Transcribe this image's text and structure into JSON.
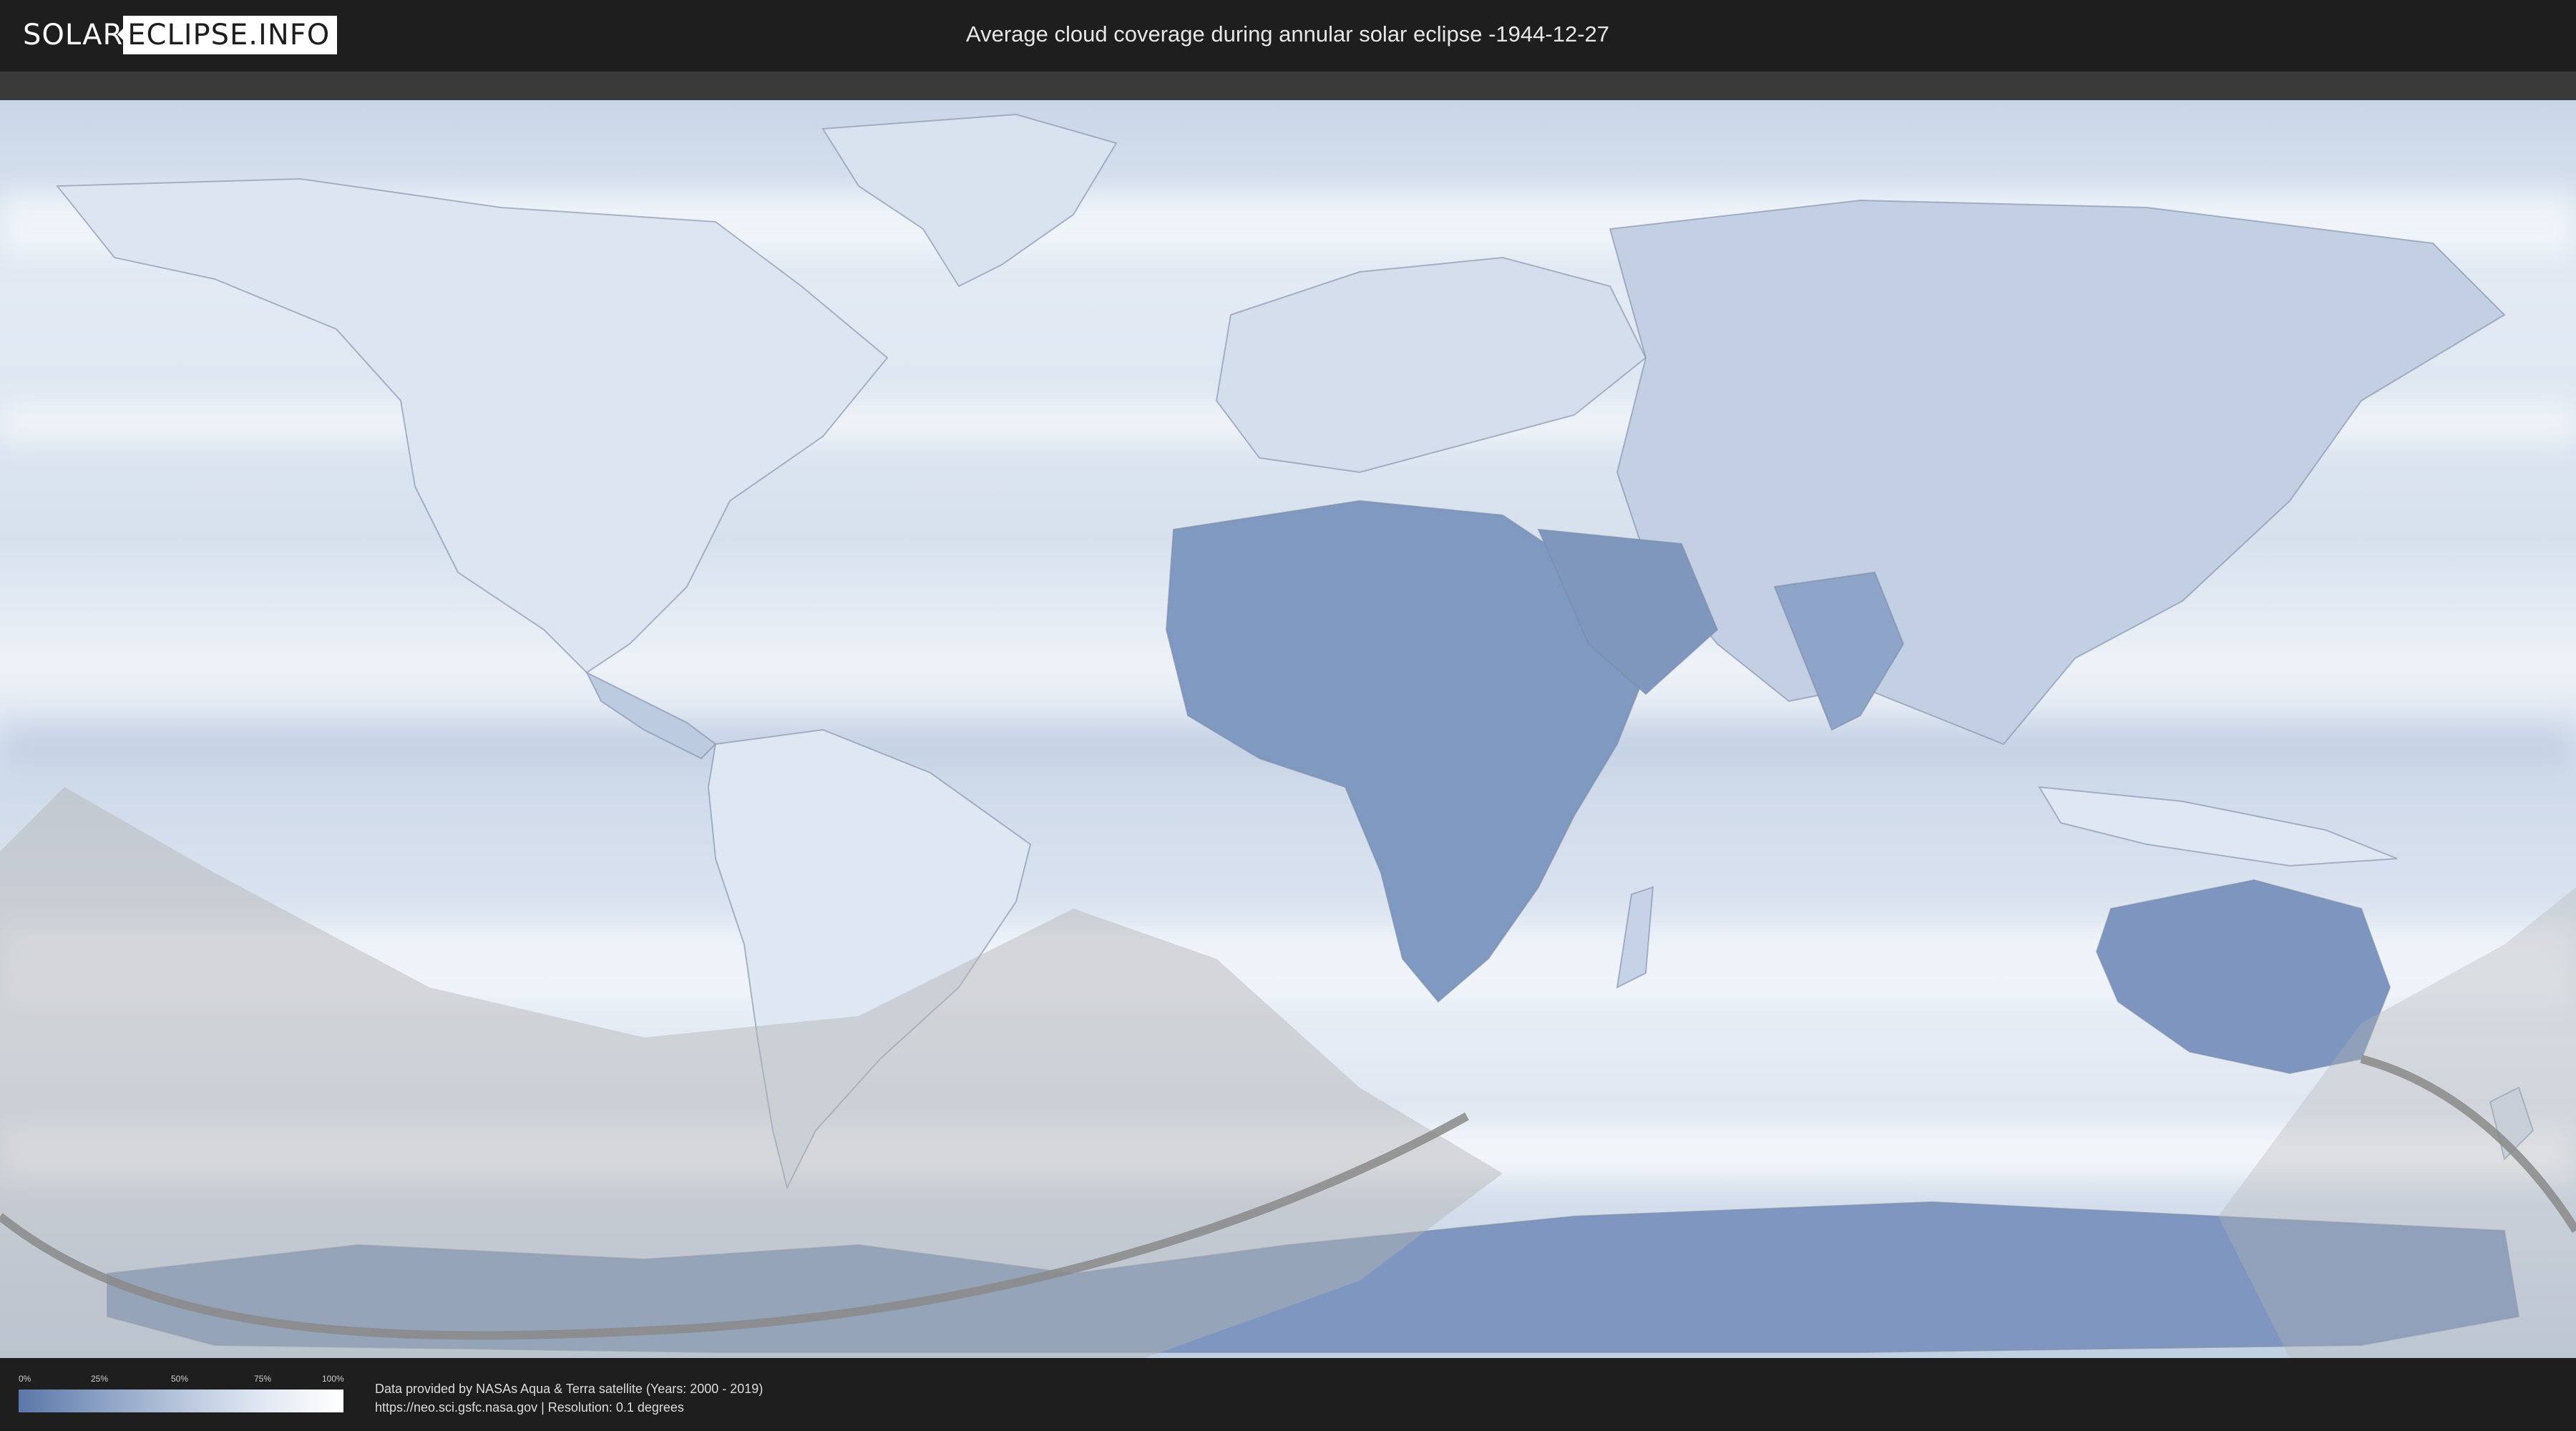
{
  "header": {
    "logo_solar": "SOLAR",
    "logo_eclipse": "ECLIPSE.INFO",
    "title": "Average cloud coverage during annular solar eclipse -1944-12-27"
  },
  "map": {
    "description_layer": "cloud-coverage",
    "colors": {
      "ocean_cloud": "#e9eff7",
      "clear_sky": "#5b77a8",
      "penumbra_shade": "#b4b4b4",
      "path_line": "#8a8a8a"
    }
  },
  "legend": {
    "ticks": [
      "0%",
      "25%",
      "50%",
      "75%",
      "100%"
    ],
    "gradient_from": "#5b77a8",
    "gradient_to": "#ffffff"
  },
  "footer": {
    "credit_line": "Data provided by NASAs Aqua & Terra satellite (Years: 2000 - 2019)",
    "source_line": "https://neo.sci.gsfc.nasa.gov | Resolution: 0.1 degrees"
  }
}
